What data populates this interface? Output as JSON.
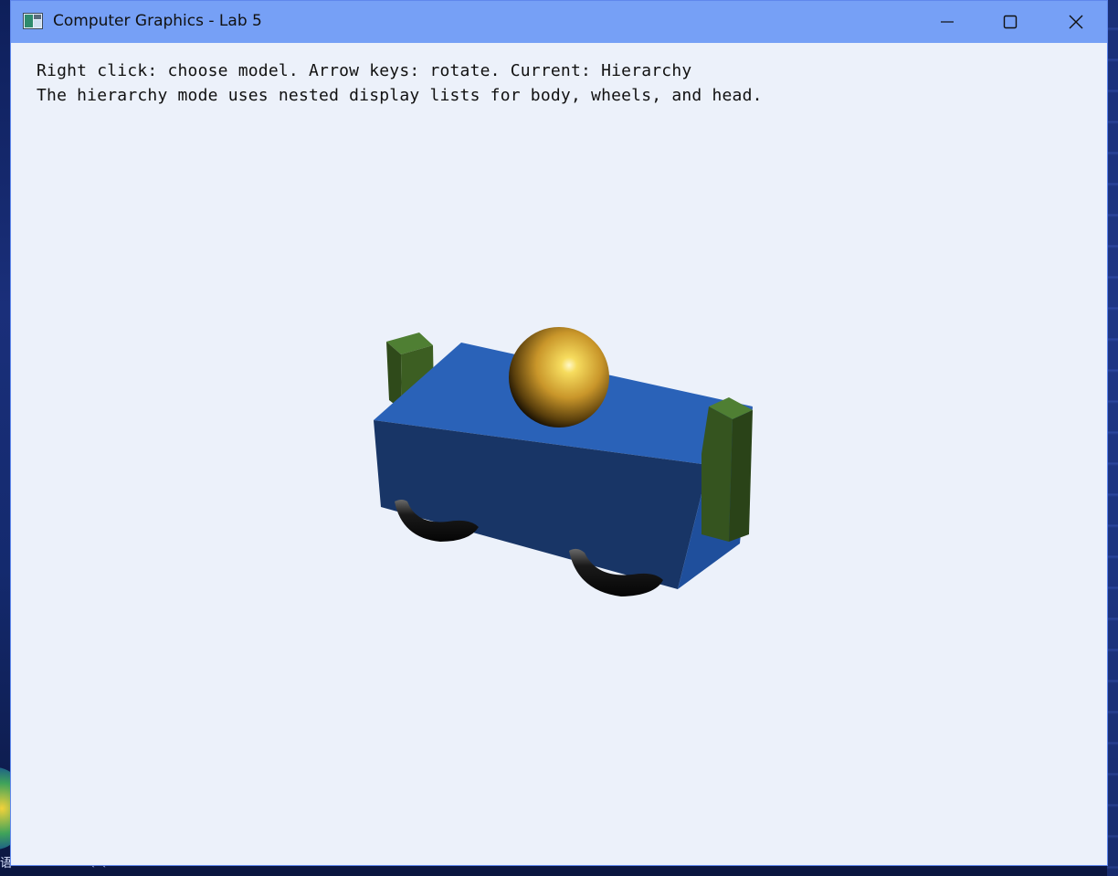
{
  "window": {
    "title": "Computer Graphics - Lab 5",
    "controls": {
      "minimize_icon": "minimize-icon",
      "maximize_icon": "maximize-icon",
      "close_icon": "close-icon"
    }
  },
  "hud": {
    "line1": "Right click: choose model. Arrow keys: rotate. Current: Hierarchy",
    "line2": "The hierarchy mode uses nested display lists for body, wheels, and head."
  },
  "scene": {
    "model": "Hierarchy",
    "parts": [
      "body",
      "wheels",
      "head",
      "arms"
    ],
    "colors": {
      "body_top": "#2a62b8",
      "body_front": "#183566",
      "body_side": "#1f4f9c",
      "arm_front": "#35541f",
      "arm_top": "#4f7f33",
      "head_gold": "#d7a72f",
      "wheel_black": "#121212",
      "background": "#ecf1fa",
      "titlebar": "#76a0f6"
    }
  }
}
